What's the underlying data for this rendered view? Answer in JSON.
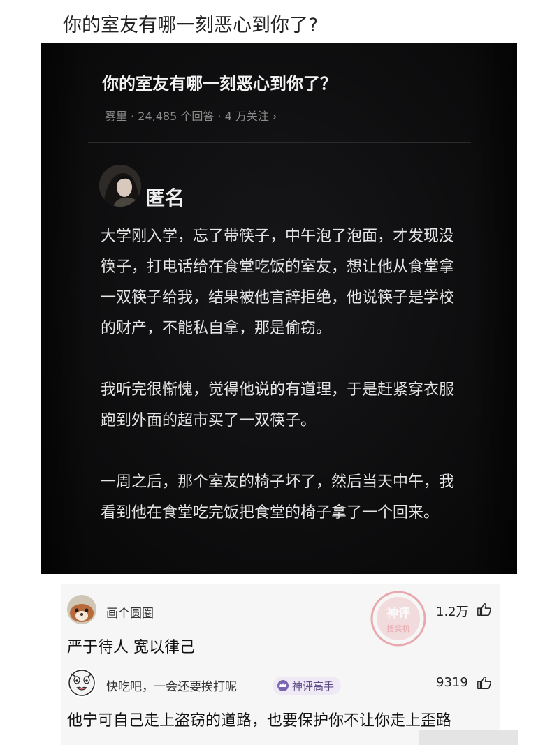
{
  "page_title": "你的室友有哪一刻恶心到你了?",
  "question": {
    "title": "你的室友有哪一刻恶心到你了？",
    "meta": "雾里 · 24,485 个回答 · 4 万关注 ›"
  },
  "answer": {
    "author": "匿名",
    "paragraphs": [
      "大学刚入学，忘了带筷子，中午泡了泡面，才发现没筷子，打电话给在食堂吃饭的室友，想让他从食堂拿一双筷子给我，结果被他言辞拒绝，他说筷子是学校的财产，不能私自拿，那是偷窃。",
      "我听完很惭愧，觉得他说的有道理，于是赶紧穿衣服跑到外面的超市买了一双筷子。",
      "一周之后，那个室友的椅子坏了，然后当天中午，我看到他在食堂吃完饭把食堂的椅子拿了一个回来。"
    ]
  },
  "comments": [
    {
      "name": "画个圆圈",
      "likes": "1.2万",
      "text": "严于待人 宽以律己"
    },
    {
      "name": "快吃吧，一会还要挨打呢",
      "badge": "神评高手",
      "likes": "9319",
      "text": "他宁可自己走上盗窃的道路，也要保护你不让你走上歪路"
    }
  ],
  "watermark": {
    "line1": "神评",
    "line2": "授奖机"
  },
  "icons": {
    "like": "thumbs-up-icon",
    "badge": "crown-badge-icon"
  },
  "colors": {
    "screenshot_bg": "#0c0c0d",
    "answer_text": "#e6e6e6",
    "meta_text": "#8c8c8c",
    "badge_bg": "#efe9f6",
    "badge_text": "#5e4d86",
    "watermark": "#e06a72"
  }
}
